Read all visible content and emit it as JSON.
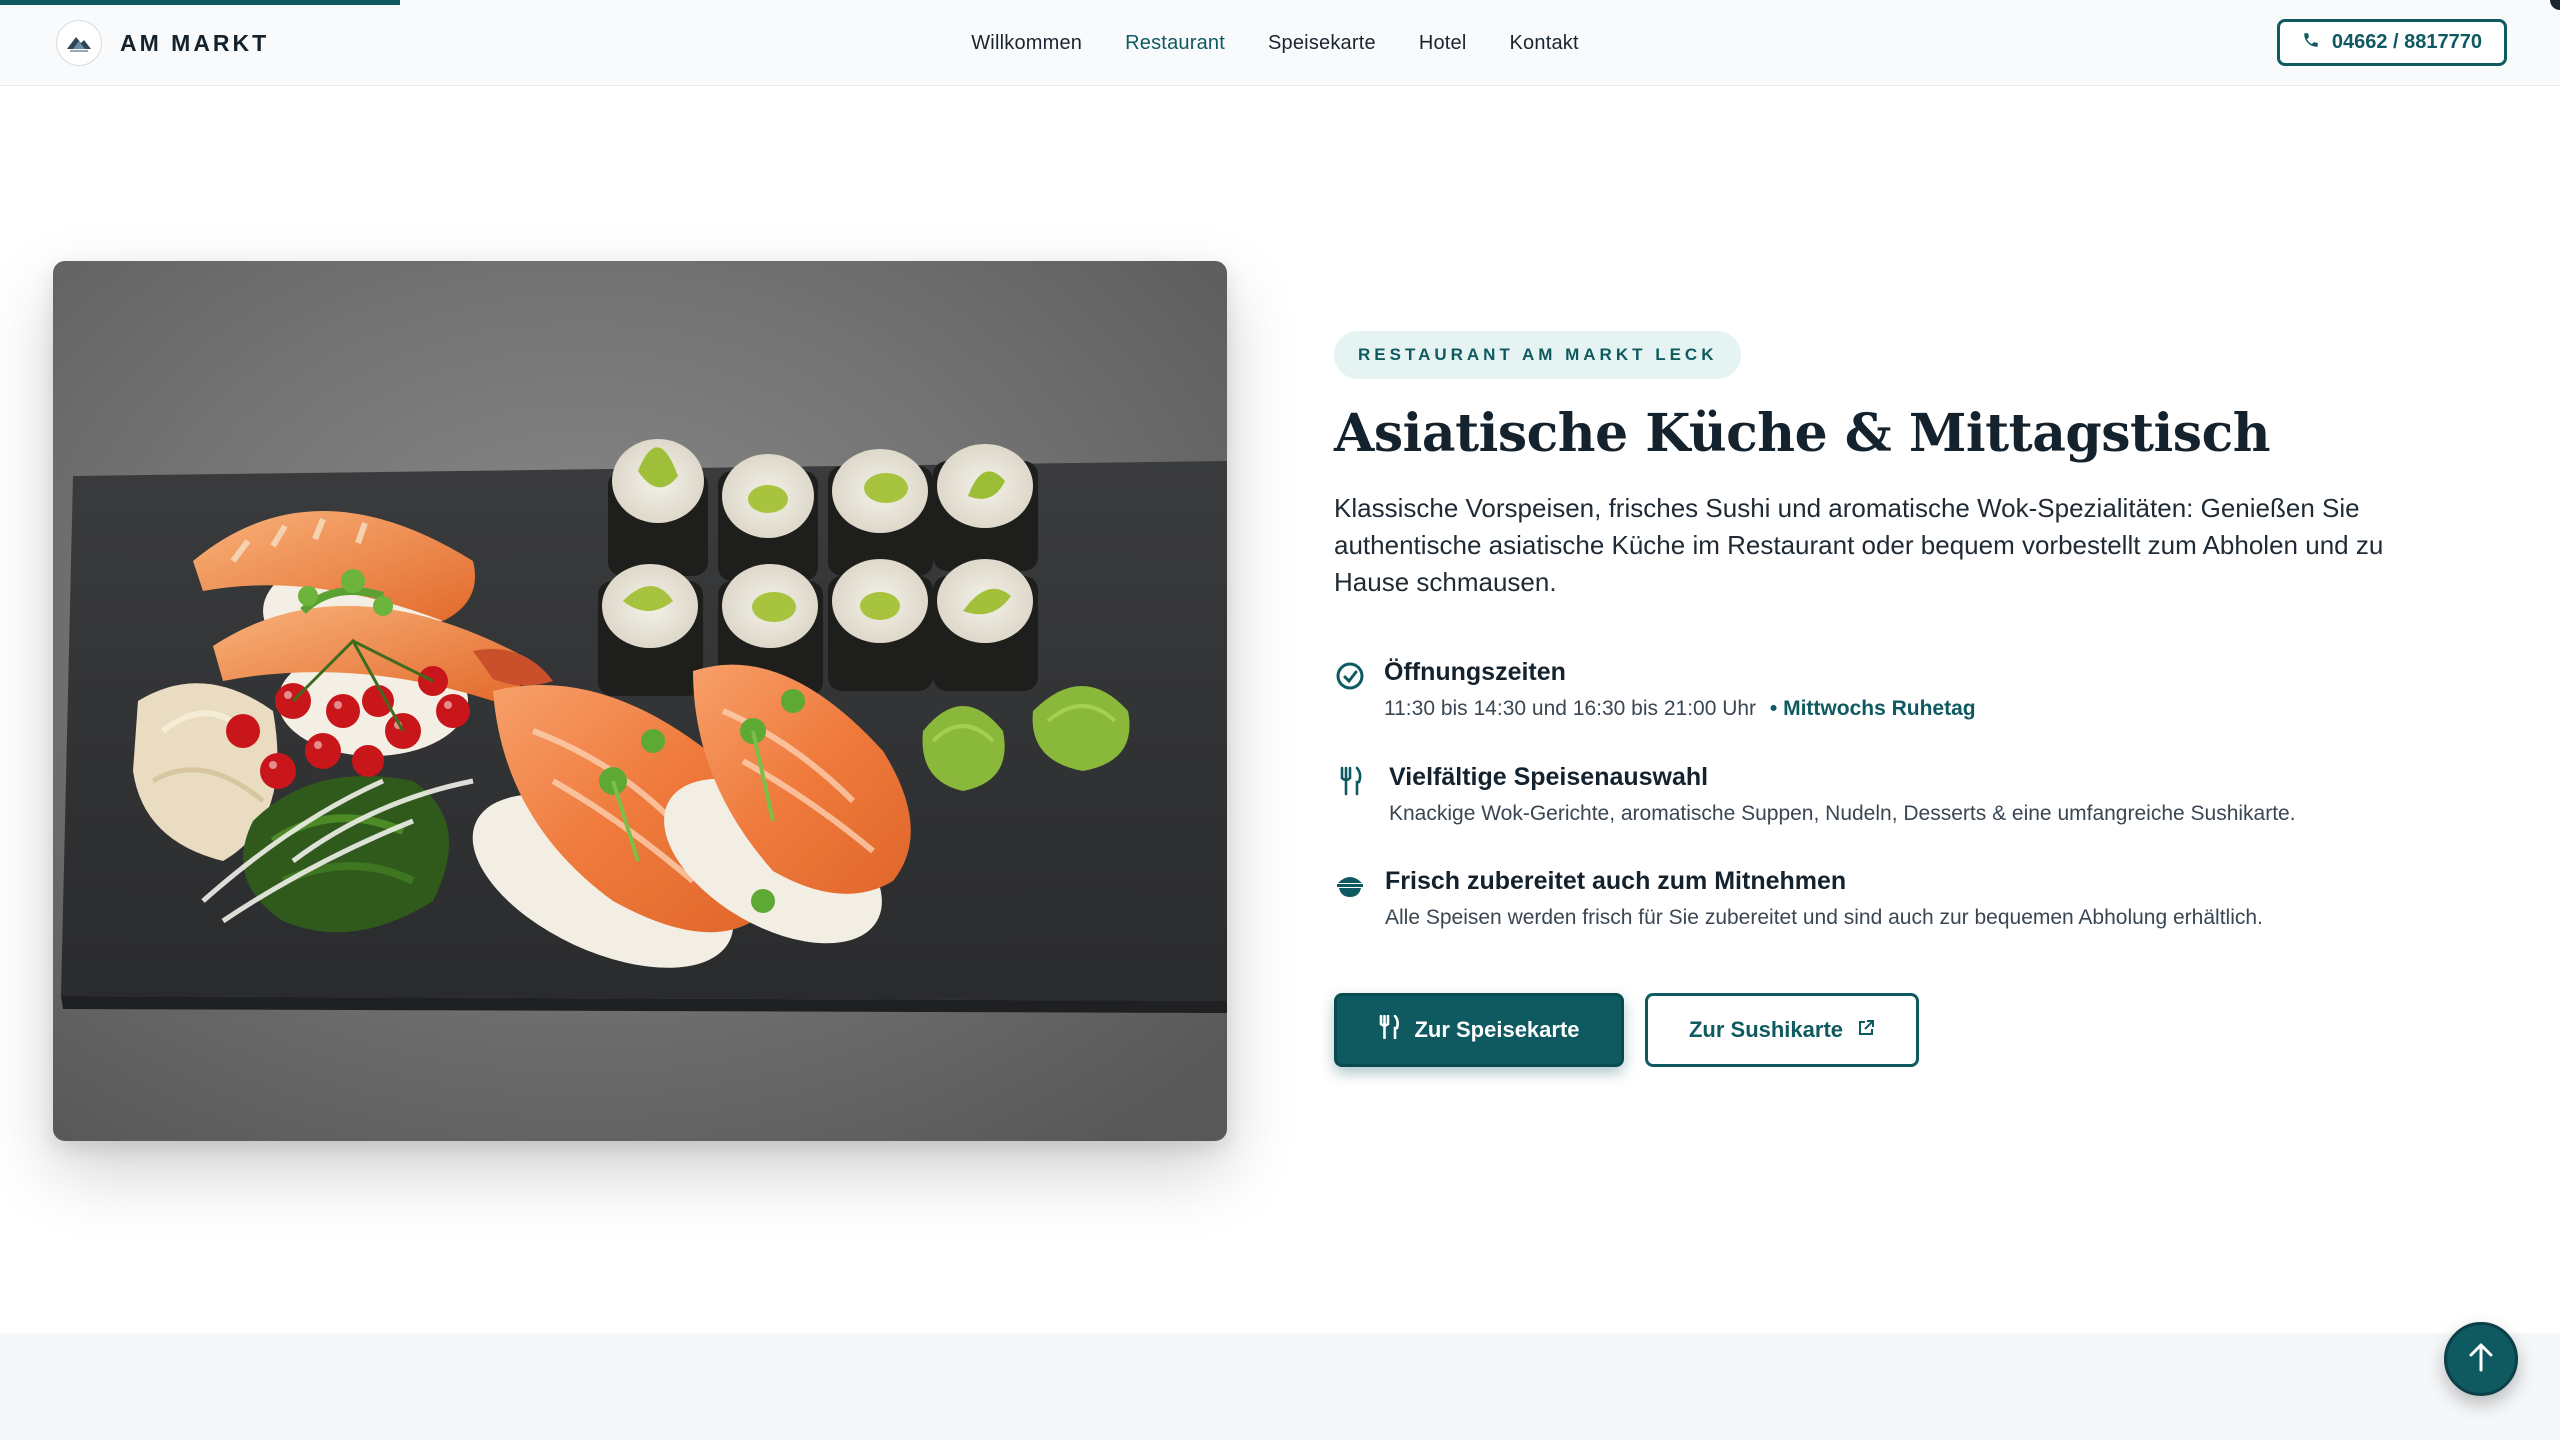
{
  "header": {
    "brand_name": "AM MARKT",
    "nav": [
      {
        "label": "Willkommen",
        "active": false
      },
      {
        "label": "Restaurant",
        "active": true
      },
      {
        "label": "Speisekarte",
        "active": false
      },
      {
        "label": "Hotel",
        "active": false
      },
      {
        "label": "Kontakt",
        "active": false
      }
    ],
    "phone_label": "04662 / 8817770"
  },
  "hero": {
    "image_alt": "Sushi auf Schieferplatte",
    "eyebrow": "RESTAURANT AM MARKT LECK",
    "title": "Asiatische Küche & Mittagstisch",
    "lead": "Klassische Vorspeisen, frisches Sushi und aromatische Wok-Spezialitäten: Genießen Sie authentische asiatische Küche im Restaurant oder bequem vorbestellt zum Abholen und zu Hause schmausen."
  },
  "features": [
    {
      "icon": "clock-icon",
      "title": "Öffnungszeiten",
      "text": "11:30 bis 14:30 und 16:30 bis 21:00 Uhr",
      "accent": "• Mittwochs Ruhetag"
    },
    {
      "icon": "fork-knife-icon",
      "title": "Vielfältige Speisenauswahl",
      "text": "Knackige Wok-Gerichte, aromatische Suppen, Nudeln, Desserts & eine umfangreiche Sushikarte."
    },
    {
      "icon": "bowl-icon",
      "title": "Frisch zubereitet auch zum Mitnehmen",
      "text": "Alle Speisen werden frisch für Sie zubereitet und sind auch zur bequemen Abholung erhältlich."
    }
  ],
  "buttons": {
    "primary_label": "Zur Speisekarte",
    "secondary_label": "Zur Sushikarte"
  },
  "colors": {
    "accent": "#0e5a60",
    "eyebrow_bg": "#e5f4f3"
  }
}
